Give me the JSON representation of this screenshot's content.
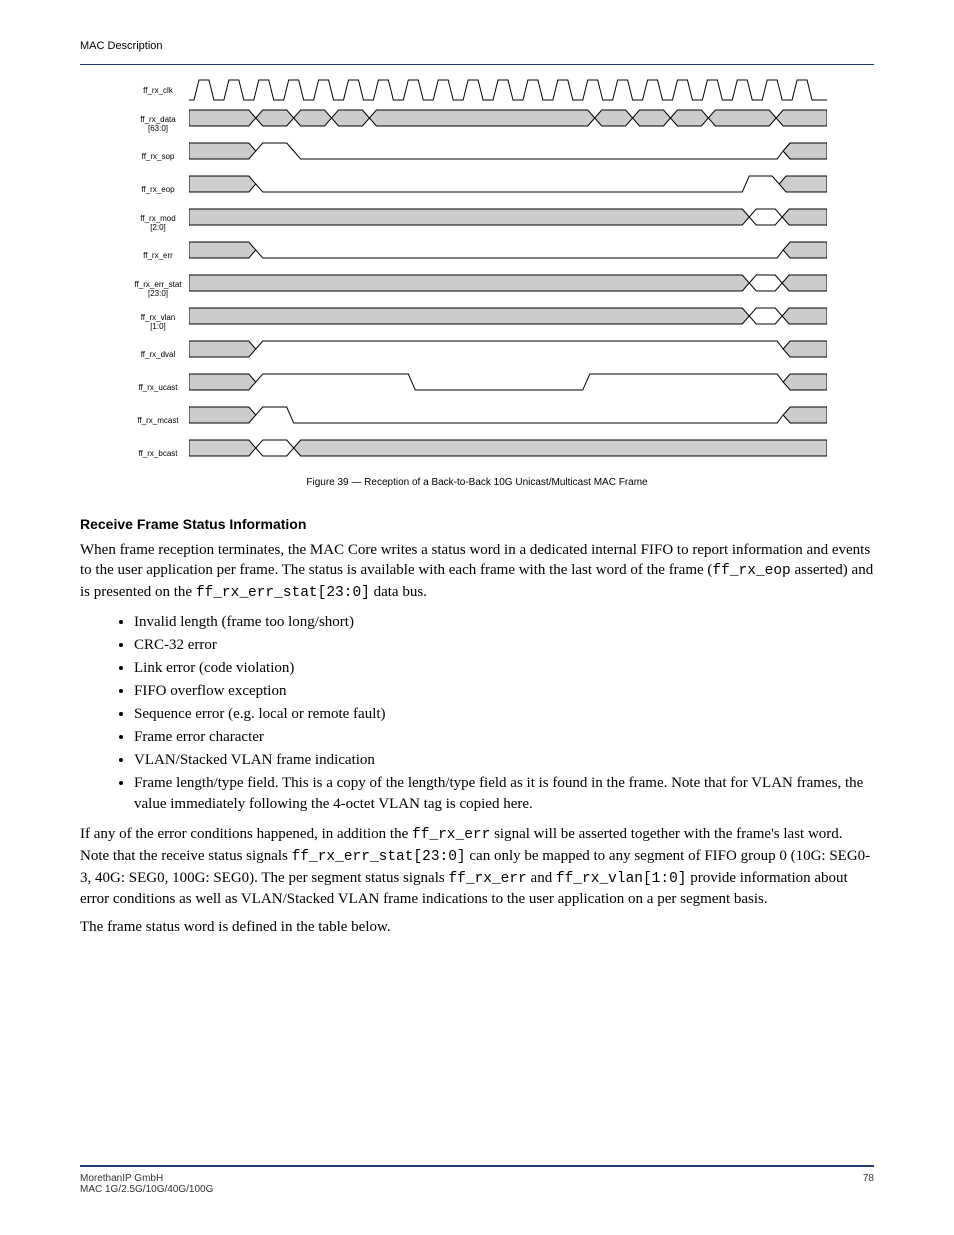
{
  "header": {
    "doc_title": "MAC Description"
  },
  "diagram": {
    "signals": [
      {
        "label": "ff_rx_clk"
      },
      {
        "label": "ff_rx_data\n[63:0]"
      },
      {
        "label": "ff_rx_sop"
      },
      {
        "label": "ff_rx_eop"
      },
      {
        "label": "ff_rx_mod\n[2:0]"
      },
      {
        "label": "ff_rx_err"
      },
      {
        "label": "ff_rx_err_stat\n[23:0]"
      },
      {
        "label": "ff_rx_vlan\n[1:0]"
      },
      {
        "label": "ff_rx_dval"
      },
      {
        "label": "ff_rx_ucast"
      },
      {
        "label": "ff_rx_mcast"
      },
      {
        "label": "ff_rx_bcast"
      }
    ],
    "caption": "Figure 39 — Reception of a Back-to-Back 10G Unicast/Multicast MAC Frame"
  },
  "section": {
    "heading": "Receive Frame Status Information",
    "p1_a": "When frame reception terminates, the MAC Core writes a status word in a dedicated internal FIFO to report information and events to the user application per frame. The status is available with each frame with the last word of the frame (",
    "p1_code1": "ff_rx_eop",
    "p1_b": " asserted) and is presented on the ",
    "p1_code2": "ff_rx_err_stat[23:0]",
    "p1_c": " data bus.",
    "bullets": [
      "Invalid length (frame too long/short)",
      "CRC-32 error",
      "Link error (code violation)",
      "FIFO overflow exception",
      "Sequence error (e.g. local or remote fault)",
      "Frame error character",
      "VLAN/Stacked VLAN frame indication",
      "Frame length/type field. This is a copy of the length/type field as it is found in the frame. Note that for VLAN frames, the value immediately following the 4-octet VLAN tag is copied here."
    ],
    "p2_a": "If any of the error conditions happened, in addition the ",
    "p2_code1": "ff_rx_err",
    "p2_b": " signal will be asserted together with the frame's last word. Note that the receive status signals ",
    "p2_code2": "ff_rx_err_stat[23:0]",
    "p2_c": " can only be mapped to any segment of FIFO group 0 (10G: SEG0-3, 40G: SEG0, 100G: SEG0). The per segment status signals ",
    "p2_code3": "ff_rx_err",
    "p2_d": " and ",
    "p2_code4": "ff_rx_vlan[1:0]",
    "p2_e": " provide information about error conditions as well as VLAN/Stacked VLAN frame indications to the user application on a per segment basis.",
    "p3": "The frame status word is defined in the table below."
  },
  "footer": {
    "left_line1": "MorethanIP GmbH",
    "left_line2": "MAC 1G/2.5G/10G/40G/100G ",
    "pagenum": "78"
  }
}
